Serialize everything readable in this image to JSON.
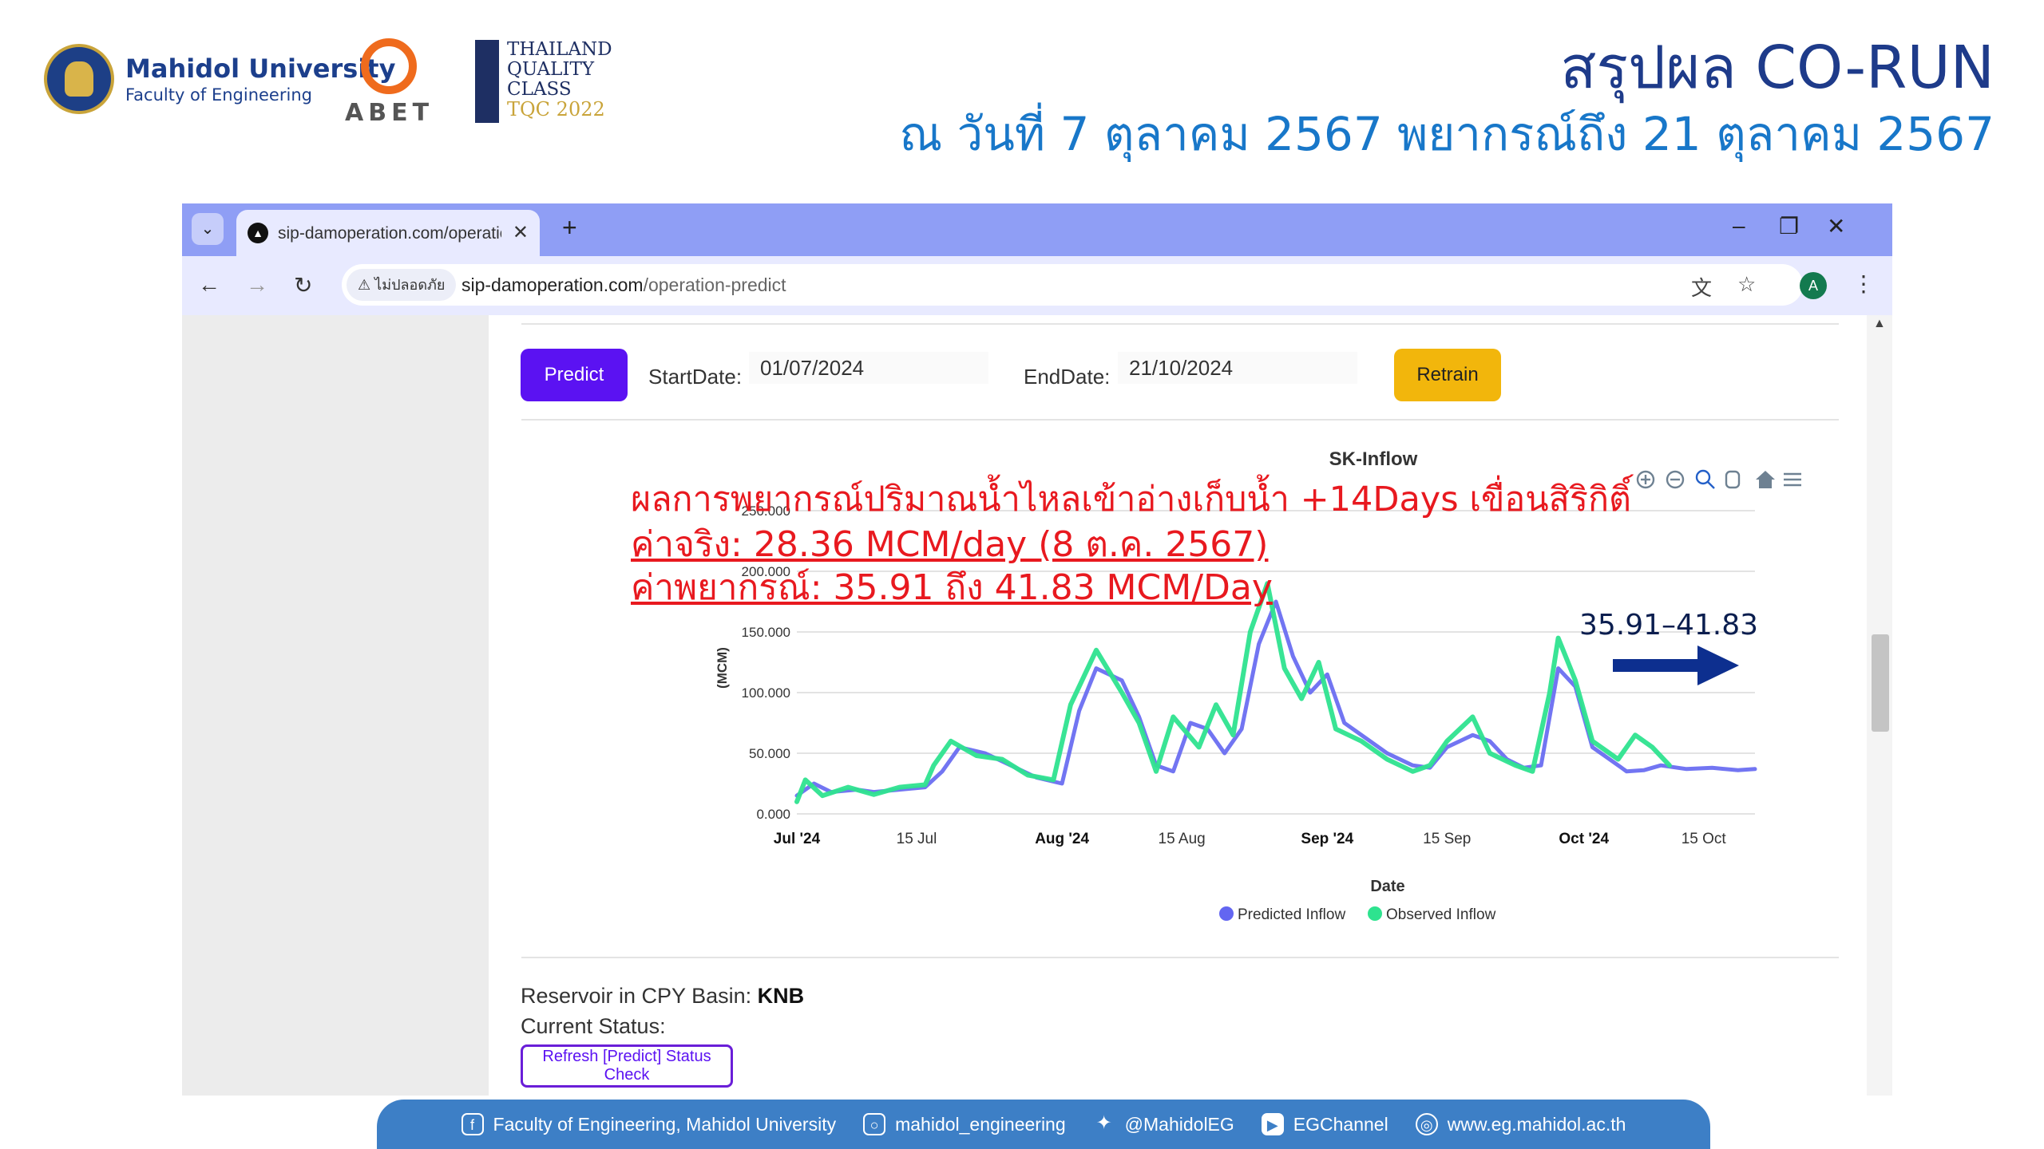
{
  "slide": {
    "university_name": "Mahidol University",
    "faculty_name": "Faculty of Engineering",
    "abet_label": "ABET",
    "tqc_line1": "THAILAND",
    "tqc_line2": "QUALITY",
    "tqc_line3": "CLASS",
    "tqc_year": "TQC 2022",
    "title": "สรุปผล CO-RUN",
    "subtitle": "ณ วันที่ 7 ตุลาคม 2567 พยากรณ์ถึง 21 ตุลาคม 2567"
  },
  "browser": {
    "tab_title": "sip-damoperation.com/operation-predict",
    "insecure_label": "ไม่ปลอดภัย",
    "url_host": "sip-damoperation.com",
    "url_path": "/operation-predict",
    "avatar_letter": "A"
  },
  "form": {
    "predict_label": "Predict",
    "start_label": "StartDate:",
    "start_value": "01/07/2024",
    "end_label": "EndDate:",
    "end_value": "21/10/2024",
    "retrain_label": "Retrain"
  },
  "annotation": {
    "line1": "ผลการพยากรณ์ปริมาณน้ำไหลเข้าอ่างเก็บน้ำ +14Days เขื่อนสิริกิติ์",
    "line2": "ค่าจริง: 28.36 MCM/day (8 ต.ค. 2567)",
    "line3": "ค่าพยากรณ์: 35.91 ถึง 41.83 MCM/Day",
    "forecast_range": "35.91–41.83"
  },
  "chart_data": {
    "type": "line",
    "title": "SK-Inflow",
    "xlabel": "Date",
    "ylabel": "(MCM)",
    "x_range": [
      "2024-07-01",
      "2024-10-21"
    ],
    "ylim": [
      0,
      250
    ],
    "ytick_labels": [
      "0.000",
      "50.000",
      "100.000",
      "150.000",
      "200.000",
      "250.000"
    ],
    "xtick_labels": [
      {
        "date": "2024-07-01",
        "label": "Jul '24",
        "bold": true
      },
      {
        "date": "2024-07-15",
        "label": "15 Jul",
        "bold": false
      },
      {
        "date": "2024-08-01",
        "label": "Aug '24",
        "bold": true
      },
      {
        "date": "2024-08-15",
        "label": "15 Aug",
        "bold": false
      },
      {
        "date": "2024-09-01",
        "label": "Sep '24",
        "bold": true
      },
      {
        "date": "2024-09-15",
        "label": "15 Sep",
        "bold": false
      },
      {
        "date": "2024-10-01",
        "label": "Oct '24",
        "bold": true
      },
      {
        "date": "2024-10-15",
        "label": "15 Oct",
        "bold": false
      }
    ],
    "legend_position": "bottom",
    "grid": true,
    "series": [
      {
        "name": "Predicted Inflow",
        "color": "#6366f1",
        "points": [
          [
            "2024-07-01",
            15
          ],
          [
            "2024-07-03",
            25
          ],
          [
            "2024-07-05",
            18
          ],
          [
            "2024-07-08",
            20
          ],
          [
            "2024-07-10",
            18
          ],
          [
            "2024-07-13",
            20
          ],
          [
            "2024-07-16",
            22
          ],
          [
            "2024-07-18",
            35
          ],
          [
            "2024-07-20",
            55
          ],
          [
            "2024-07-23",
            50
          ],
          [
            "2024-07-26",
            40
          ],
          [
            "2024-07-29",
            30
          ],
          [
            "2024-08-01",
            25
          ],
          [
            "2024-08-03",
            85
          ],
          [
            "2024-08-05",
            120
          ],
          [
            "2024-08-08",
            110
          ],
          [
            "2024-08-10",
            80
          ],
          [
            "2024-08-12",
            40
          ],
          [
            "2024-08-14",
            35
          ],
          [
            "2024-08-16",
            75
          ],
          [
            "2024-08-18",
            70
          ],
          [
            "2024-08-20",
            50
          ],
          [
            "2024-08-22",
            70
          ],
          [
            "2024-08-24",
            140
          ],
          [
            "2024-08-26",
            175
          ],
          [
            "2024-08-28",
            130
          ],
          [
            "2024-08-30",
            100
          ],
          [
            "2024-09-01",
            115
          ],
          [
            "2024-09-03",
            75
          ],
          [
            "2024-09-05",
            65
          ],
          [
            "2024-09-08",
            50
          ],
          [
            "2024-09-11",
            40
          ],
          [
            "2024-09-13",
            38
          ],
          [
            "2024-09-15",
            55
          ],
          [
            "2024-09-18",
            65
          ],
          [
            "2024-09-20",
            60
          ],
          [
            "2024-09-22",
            45
          ],
          [
            "2024-09-24",
            38
          ],
          [
            "2024-09-26",
            40
          ],
          [
            "2024-09-28",
            120
          ],
          [
            "2024-09-30",
            105
          ],
          [
            "2024-10-02",
            55
          ],
          [
            "2024-10-04",
            45
          ],
          [
            "2024-10-06",
            35
          ],
          [
            "2024-10-08",
            36
          ],
          [
            "2024-10-10",
            40
          ],
          [
            "2024-10-13",
            37
          ],
          [
            "2024-10-16",
            38
          ],
          [
            "2024-10-19",
            36
          ],
          [
            "2024-10-21",
            37
          ]
        ]
      },
      {
        "name": "Observed Inflow",
        "color": "#2ee38f",
        "points": [
          [
            "2024-07-01",
            10
          ],
          [
            "2024-07-02",
            28
          ],
          [
            "2024-07-04",
            15
          ],
          [
            "2024-07-07",
            22
          ],
          [
            "2024-07-10",
            16
          ],
          [
            "2024-07-13",
            22
          ],
          [
            "2024-07-16",
            24
          ],
          [
            "2024-07-17",
            40
          ],
          [
            "2024-07-19",
            60
          ],
          [
            "2024-07-22",
            48
          ],
          [
            "2024-07-25",
            45
          ],
          [
            "2024-07-28",
            32
          ],
          [
            "2024-07-31",
            28
          ],
          [
            "2024-08-02",
            90
          ],
          [
            "2024-08-05",
            135
          ],
          [
            "2024-08-08",
            100
          ],
          [
            "2024-08-10",
            75
          ],
          [
            "2024-08-12",
            35
          ],
          [
            "2024-08-14",
            80
          ],
          [
            "2024-08-17",
            55
          ],
          [
            "2024-08-19",
            90
          ],
          [
            "2024-08-21",
            65
          ],
          [
            "2024-08-23",
            150
          ],
          [
            "2024-08-25",
            190
          ],
          [
            "2024-08-27",
            120
          ],
          [
            "2024-08-29",
            95
          ],
          [
            "2024-08-31",
            125
          ],
          [
            "2024-09-02",
            70
          ],
          [
            "2024-09-05",
            60
          ],
          [
            "2024-09-08",
            45
          ],
          [
            "2024-09-11",
            35
          ],
          [
            "2024-09-13",
            40
          ],
          [
            "2024-09-15",
            60
          ],
          [
            "2024-09-18",
            80
          ],
          [
            "2024-09-20",
            50
          ],
          [
            "2024-09-23",
            40
          ],
          [
            "2024-09-25",
            35
          ],
          [
            "2024-09-27",
            100
          ],
          [
            "2024-09-28",
            145
          ],
          [
            "2024-09-30",
            110
          ],
          [
            "2024-10-02",
            60
          ],
          [
            "2024-10-04",
            50
          ],
          [
            "2024-10-05",
            45
          ],
          [
            "2024-10-07",
            65
          ],
          [
            "2024-10-09",
            55
          ],
          [
            "2024-10-11",
            40
          ]
        ]
      }
    ]
  },
  "chart_toolbar": [
    "zoom-in-icon",
    "zoom-out-icon",
    "selection-zoom-icon",
    "pan-hand-icon",
    "reset-home-icon",
    "menu-icon"
  ],
  "reservoir": {
    "label": "Reservoir in CPY Basin:",
    "value": "KNB",
    "status_label": "Current Status:",
    "refresh_label": "Refresh [Predict] Status Check"
  },
  "footer": {
    "facebook": "Faculty of Engineering, Mahidol University",
    "instagram": "mahidol_engineering",
    "twitter": "@MahidolEG",
    "youtube": "EGChannel",
    "website": "www.eg.mahidol.ac.th"
  },
  "colors": {
    "brand_blue": "#1e3b8a",
    "subtitle_blue": "#1877c9",
    "predict_button": "#5b12f2",
    "retrain_button": "#f2b60c",
    "annotation_red": "#e8191f",
    "arrow_navy": "#0d2f8f",
    "footer_blue": "#3d7fc6"
  }
}
